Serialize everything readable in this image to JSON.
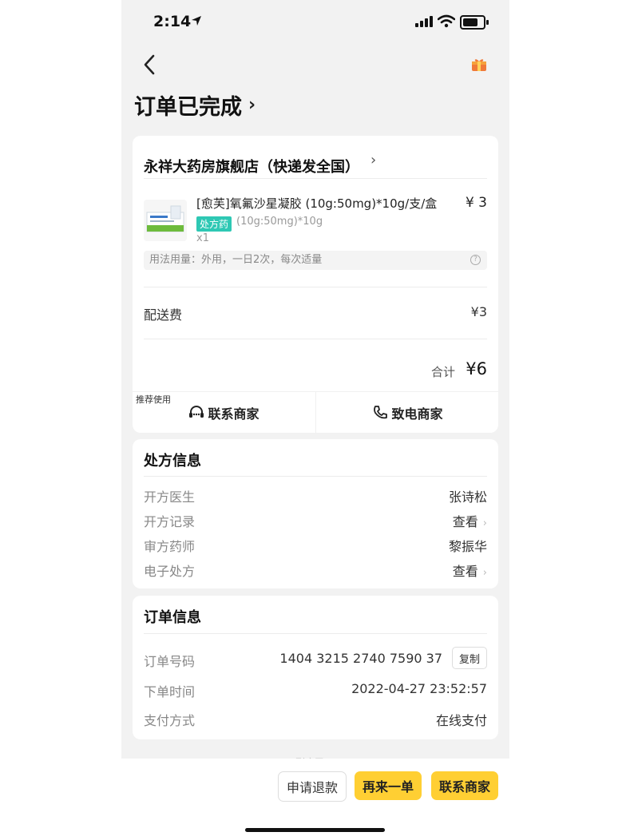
{
  "status_bar": {
    "time": "2:14"
  },
  "header": {
    "title": "订单已完成"
  },
  "shop_card": {
    "shop_name": "永祥大药房旗舰店（快递发全国）",
    "product": {
      "name": "[愈芙]氧氟沙星凝胶 (10g:50mg)*10g/支/盒",
      "price": "¥ 3",
      "rx_tag": "处方药",
      "spec": "(10g:50mg)*10g",
      "qty": "x1",
      "usage": "用法用量：外用，一日2次，每次适量"
    },
    "delivery_label": "配送费",
    "delivery_value": "¥3",
    "total_label": "合计",
    "total_value": "¥6",
    "recommend_tag": "推荐使用",
    "contact_merchant": "联系商家",
    "call_merchant": "致电商家"
  },
  "prescription": {
    "title": "处方信息",
    "rows": [
      {
        "label": "开方医生",
        "value": "张诗松"
      },
      {
        "label": "开方记录",
        "value": "查看"
      },
      {
        "label": "审方药师",
        "value": "黎振华"
      },
      {
        "label": "电子处方",
        "value": "查看"
      }
    ]
  },
  "order_info": {
    "title": "订单信息",
    "rows": [
      {
        "label": "订单号码",
        "value": "1404 3215 2740 7590 37"
      },
      {
        "label": "下单时间",
        "value": "2022-04-27 23:52:57"
      },
      {
        "label": "支付方式",
        "value": "在线支付"
      }
    ],
    "copy_label": "复制"
  },
  "footer": {
    "end_text": "到底了~",
    "refund": "申请退款",
    "reorder": "再来一单",
    "contact": "联系商家"
  },
  "colors": {
    "accent": "#ffcf33",
    "rx_tag": "#2ec8b4",
    "background": "#f2f2f2"
  }
}
